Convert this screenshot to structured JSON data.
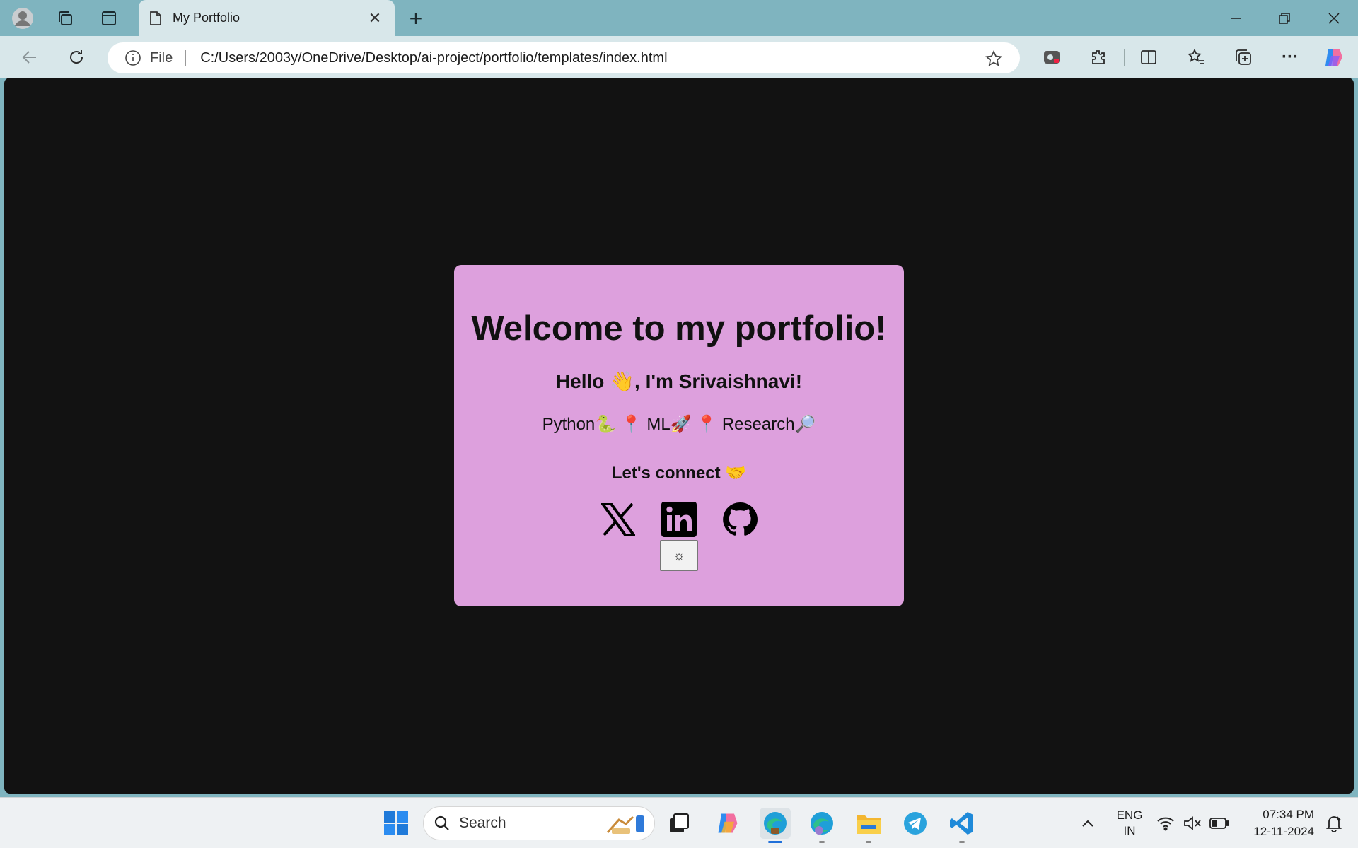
{
  "browser": {
    "tab_title": "My Portfolio",
    "tab_close": "✕",
    "new_tab": "+",
    "address": {
      "scheme": "File",
      "url": "C:/Users/2003y/OneDrive/Desktop/ai-project/portfolio/templates/index.html"
    }
  },
  "page": {
    "heading": "Welcome to my portfolio!",
    "greeting": "Hello 👋, I'm Srivaishnavi!",
    "skills": "Python🐍 📍 ML🚀 📍 Research🔎",
    "connect": "Let's connect 🤝",
    "theme_toggle": "☼",
    "socials": [
      "x-twitter-icon",
      "linkedin-icon",
      "github-icon"
    ],
    "colors": {
      "card": "#dda0dd",
      "background": "#121212"
    }
  },
  "taskbar": {
    "search_label": "Search",
    "lang_line1": "ENG",
    "lang_line2": "IN",
    "time": "07:34 PM",
    "date": "12-11-2024"
  }
}
